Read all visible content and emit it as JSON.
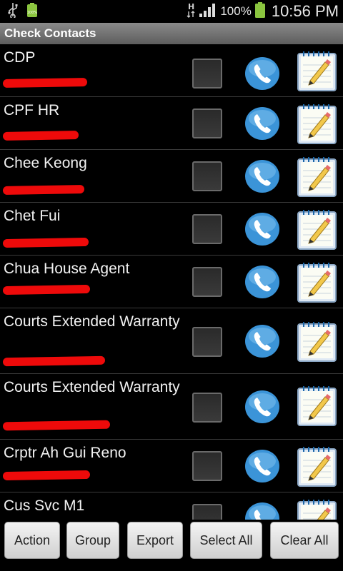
{
  "status_bar": {
    "battery_percent": "100%",
    "time": "10:56 PM",
    "signal_label": "H",
    "icons": [
      "usb-icon",
      "battery-full-small-icon",
      "hspa-data-icon",
      "signal-strength-icon",
      "battery-icon"
    ]
  },
  "app": {
    "title": "Check Contacts"
  },
  "contacts": [
    {
      "name": "CDP"
    },
    {
      "name": "CPF HR"
    },
    {
      "name": "Chee Keong"
    },
    {
      "name": "Chet Fui"
    },
    {
      "name": "Chua House Agent"
    },
    {
      "name": "Courts Extended Warranty"
    },
    {
      "name": "Courts Extended Warranty"
    },
    {
      "name": "Crptr Ah Gui Reno"
    },
    {
      "name": "Cus Svc M1"
    }
  ],
  "buttons": {
    "action": "Action",
    "group": "Group",
    "export": "Export",
    "select_all": "Select All",
    "clear_all": "Clear All"
  },
  "colors": {
    "title_bar": "#6e6e6e",
    "redaction": "#ee0a0a",
    "call_icon": "#3b94d8"
  }
}
